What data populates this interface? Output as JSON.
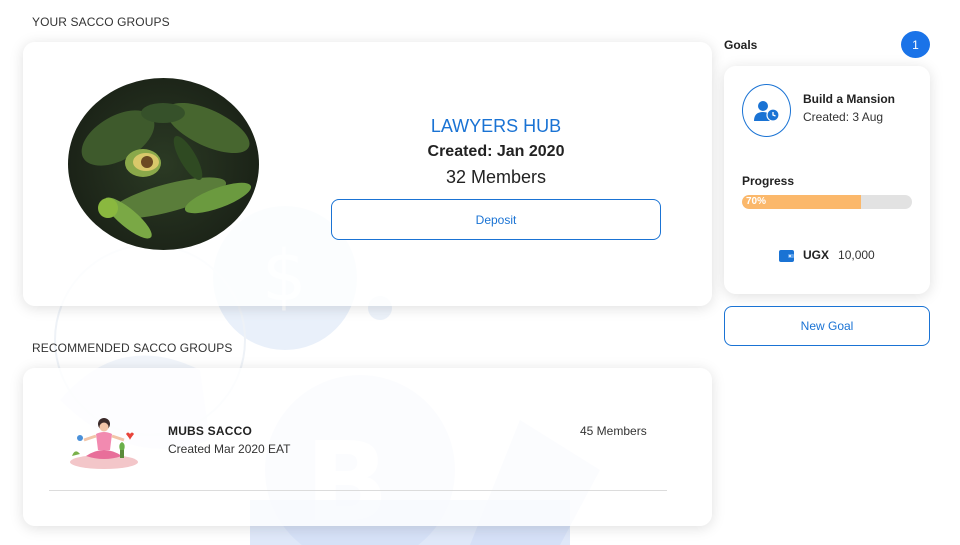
{
  "your_groups": {
    "section_title": "YOUR SACCO GROUPS",
    "group": {
      "name": "LAWYERS HUB",
      "created": "Created: Jan 2020",
      "members": "32 Members",
      "deposit_label": "Deposit"
    }
  },
  "recommended": {
    "section_title": "RECOMMENDED SACCO GROUPS",
    "items": [
      {
        "name": "MUBS SACCO",
        "created": "Created Mar 2020 EAT",
        "members": "45 Members"
      }
    ]
  },
  "goals": {
    "label": "Goals",
    "count": "1",
    "items": [
      {
        "name": "Build a Mansion",
        "created": "Created: 3 Aug",
        "progress_label": "Progress",
        "progress_text": "70%",
        "progress_value": 0.7,
        "currency": "UGX",
        "amount": "10,000"
      }
    ],
    "new_goal_label": "New Goal"
  },
  "colors": {
    "accent": "#1a73d4",
    "badge": "#1a73e8",
    "progress": "#fbb86b"
  }
}
